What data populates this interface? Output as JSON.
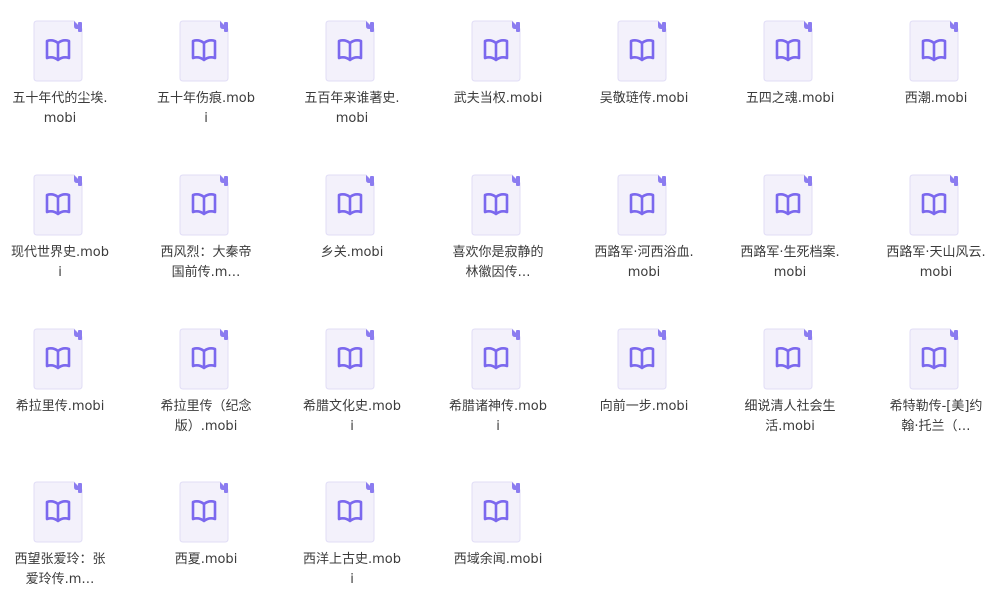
{
  "files": [
    {
      "name": "五十年代的尘埃.mobi"
    },
    {
      "name": "五十年伤痕.mobi"
    },
    {
      "name": "五百年来谁著史.mobi"
    },
    {
      "name": "武夫当权.mobi"
    },
    {
      "name": "吴敬琏传.mobi"
    },
    {
      "name": "五四之魂.mobi"
    },
    {
      "name": "西潮.mobi"
    },
    {
      "name": "现代世界史.mobi"
    },
    {
      "name": "西风烈：大秦帝国前传.m…"
    },
    {
      "name": "乡关.mobi"
    },
    {
      "name": "喜欢你是寂静的 林徽因传…"
    },
    {
      "name": "西路军·河西浴血.mobi"
    },
    {
      "name": "西路军·生死档案.mobi"
    },
    {
      "name": "西路军·天山风云.mobi"
    },
    {
      "name": "希拉里传.mobi"
    },
    {
      "name": "希拉里传（纪念版）.mobi"
    },
    {
      "name": "希腊文化史.mobi"
    },
    {
      "name": "希腊诸神传.mobi"
    },
    {
      "name": "向前一步.mobi"
    },
    {
      "name": "细说清人社会生活.mobi"
    },
    {
      "name": "希特勒传-[美]约翰·托兰（…"
    },
    {
      "name": "西望张爱玲：张爱玲传.m…"
    },
    {
      "name": "西夏.mobi"
    },
    {
      "name": "西洋上古史.mobi"
    },
    {
      "name": "西域余闻.mobi"
    }
  ],
  "icon": {
    "name": "ebook-file-icon",
    "page_color": "#f3f1fb",
    "fold_color": "#8b7cf0",
    "book_color": "#7b68ee"
  }
}
